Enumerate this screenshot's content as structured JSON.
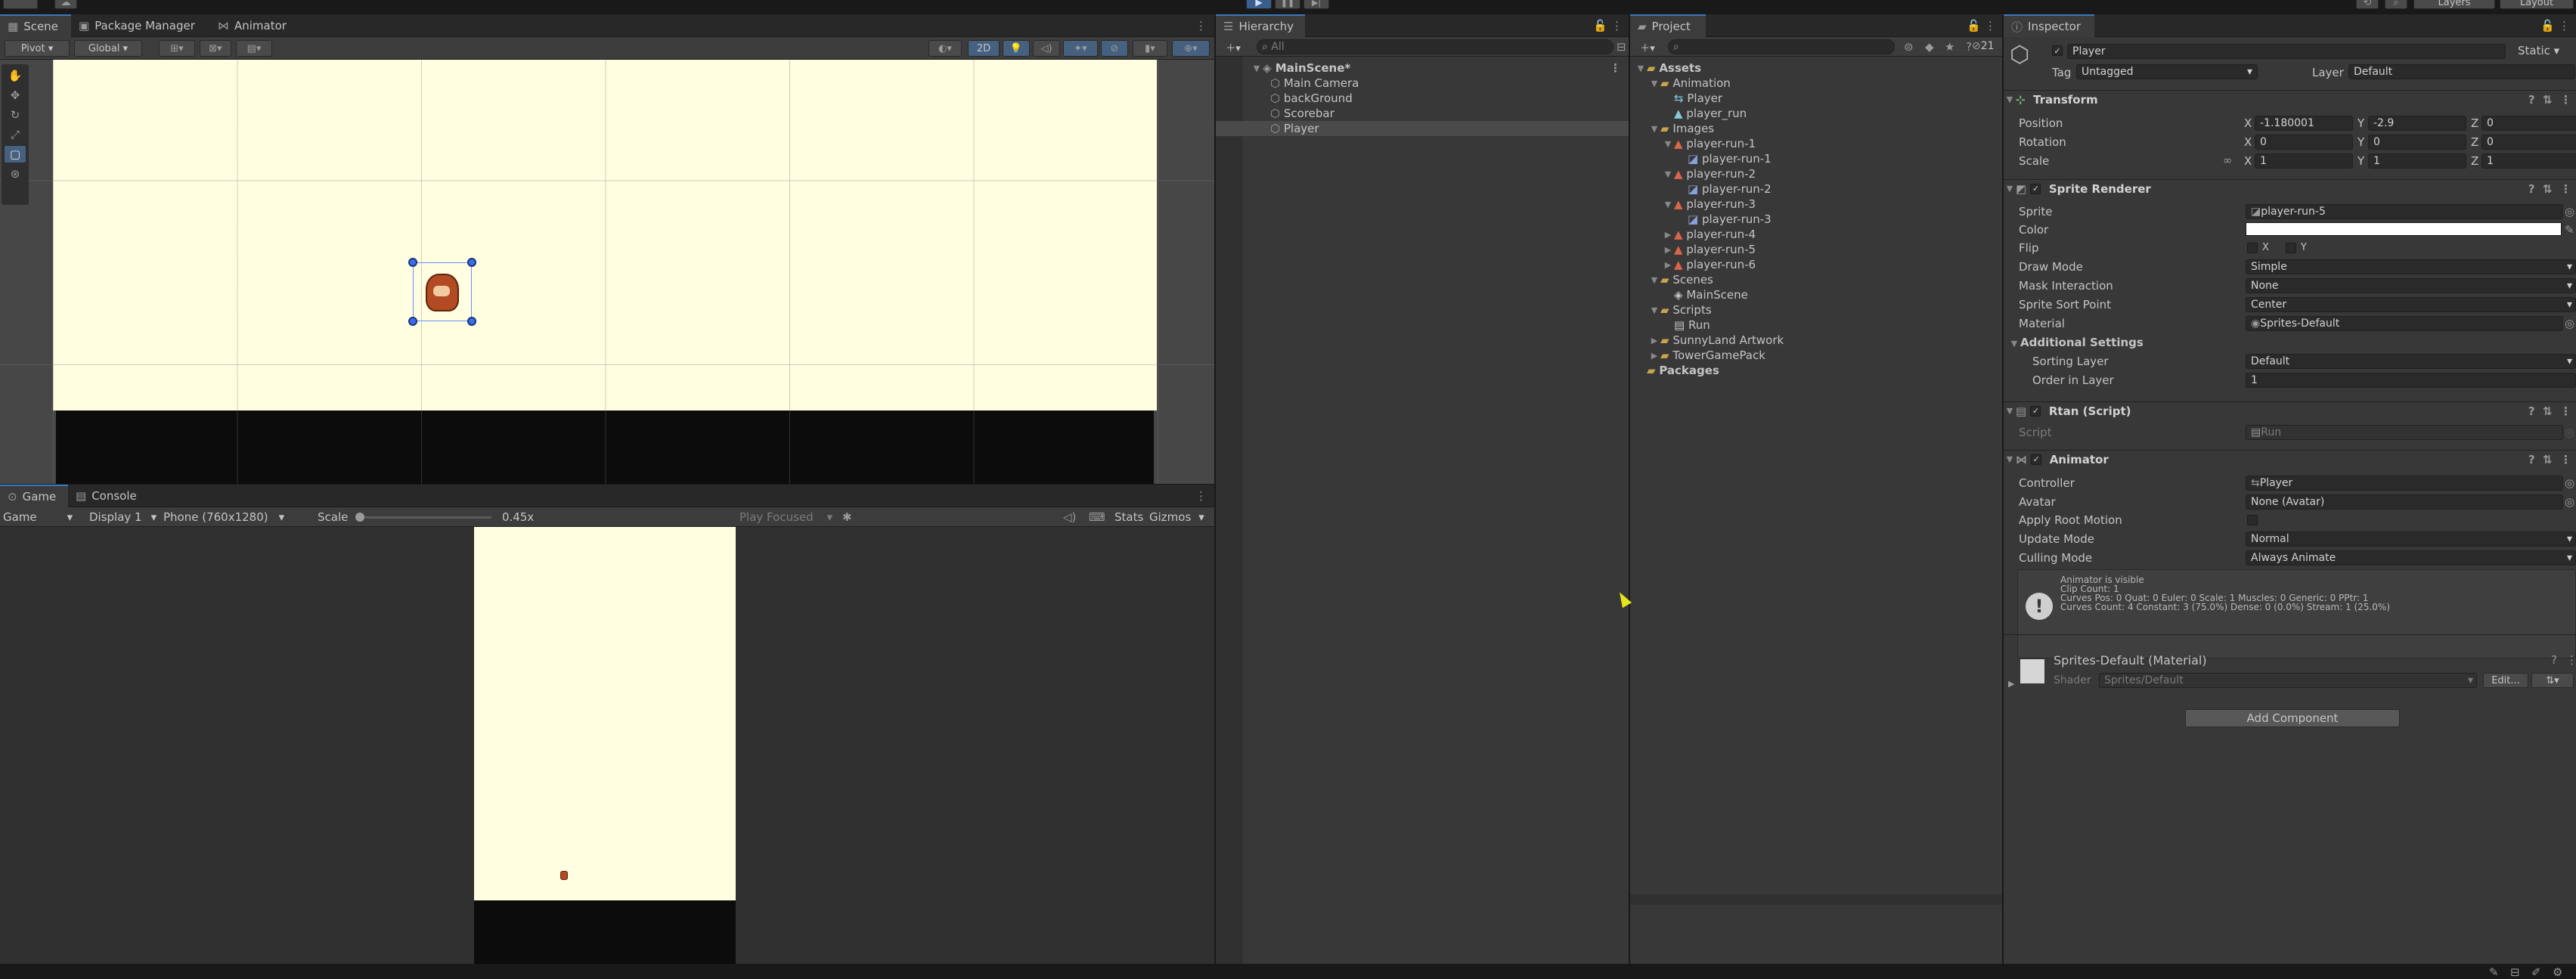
{
  "top_toolbar": {
    "layers": "Layers",
    "layout": "Layout"
  },
  "scene_tabs": [
    "Scene",
    "Package Manager",
    "Animator"
  ],
  "scene_toolbar": {
    "pivot": "Pivot",
    "global": "Global",
    "two_d": "2D"
  },
  "game_tabs": [
    "Game",
    "Console"
  ],
  "game_toolbar": {
    "mode": "Game",
    "display": "Display 1",
    "resolution": "Phone (760x1280)",
    "scale_label": "Scale",
    "scale_value": "0.45x",
    "play_focused": "Play Focused",
    "stats": "Stats",
    "gizmos": "Gizmos"
  },
  "hierarchy": {
    "tab": "Hierarchy",
    "search_placeholder": "All",
    "scene": "MainScene*",
    "items": [
      "Main Camera",
      "backGround",
      "Scorebar",
      "Player"
    ]
  },
  "project": {
    "tab": "Project",
    "hidden_count": "21",
    "tree": [
      {
        "label": "Assets",
        "depth": 0,
        "icon": "folder",
        "exp": "open"
      },
      {
        "label": "Animation",
        "depth": 1,
        "icon": "folder",
        "exp": "open"
      },
      {
        "label": "Player",
        "depth": 2,
        "icon": "anim",
        "exp": ""
      },
      {
        "label": "player_run",
        "depth": 2,
        "icon": "clip",
        "exp": ""
      },
      {
        "label": "Images",
        "depth": 1,
        "icon": "folder",
        "exp": "open"
      },
      {
        "label": "player-run-1",
        "depth": 2,
        "icon": "tex",
        "exp": "open"
      },
      {
        "label": "player-run-1",
        "depth": 3,
        "icon": "sprite",
        "exp": ""
      },
      {
        "label": "player-run-2",
        "depth": 2,
        "icon": "tex",
        "exp": "open"
      },
      {
        "label": "player-run-2",
        "depth": 3,
        "icon": "sprite",
        "exp": ""
      },
      {
        "label": "player-run-3",
        "depth": 2,
        "icon": "tex",
        "exp": "open"
      },
      {
        "label": "player-run-3",
        "depth": 3,
        "icon": "sprite",
        "exp": ""
      },
      {
        "label": "player-run-4",
        "depth": 2,
        "icon": "tex",
        "exp": "closed"
      },
      {
        "label": "player-run-5",
        "depth": 2,
        "icon": "tex",
        "exp": "closed"
      },
      {
        "label": "player-run-6",
        "depth": 2,
        "icon": "tex",
        "exp": "closed"
      },
      {
        "label": "Scenes",
        "depth": 1,
        "icon": "folder",
        "exp": "open"
      },
      {
        "label": "MainScene",
        "depth": 2,
        "icon": "unity",
        "exp": ""
      },
      {
        "label": "Scripts",
        "depth": 1,
        "icon": "folder",
        "exp": "open"
      },
      {
        "label": "Run",
        "depth": 2,
        "icon": "script",
        "exp": ""
      },
      {
        "label": "SunnyLand Artwork",
        "depth": 1,
        "icon": "folder",
        "exp": "closed"
      },
      {
        "label": "TowerGamePack",
        "depth": 1,
        "icon": "folder",
        "exp": "closed"
      },
      {
        "label": "Packages",
        "depth": 0,
        "icon": "folder",
        "exp": ""
      }
    ]
  },
  "inspector": {
    "tab": "Inspector",
    "object_name": "Player",
    "static": "Static",
    "tag_label": "Tag",
    "tag_value": "Untagged",
    "layer_label": "Layer",
    "layer_value": "Default",
    "transform": {
      "title": "Transform",
      "position_label": "Position",
      "position": [
        "-1.180001",
        "-2.9",
        "0"
      ],
      "rotation_label": "Rotation",
      "rotation": [
        "0",
        "0",
        "0"
      ],
      "scale_label": "Scale",
      "scale": [
        "1",
        "1",
        "1"
      ]
    },
    "sprite_renderer": {
      "title": "Sprite Renderer",
      "sprite_label": "Sprite",
      "sprite": "player-run-5",
      "color_label": "Color",
      "flip_label": "Flip",
      "flip_x": "X",
      "flip_y": "Y",
      "draw_mode_label": "Draw Mode",
      "draw_mode": "Simple",
      "mask_label": "Mask Interaction",
      "mask": "None",
      "sort_point_label": "Sprite Sort Point",
      "sort_point": "Center",
      "material_label": "Material",
      "material": "Sprites-Default",
      "additional": "Additional Settings",
      "sorting_layer_label": "Sorting Layer",
      "sorting_layer": "Default",
      "order_label": "Order in Layer",
      "order": "1"
    },
    "script": {
      "title": "Rtan (Script)",
      "script_label": "Script",
      "script_value": "Run"
    },
    "animator": {
      "title": "Animator",
      "controller_label": "Controller",
      "controller": "Player",
      "avatar_label": "Avatar",
      "avatar": "None (Avatar)",
      "root_motion_label": "Apply Root Motion",
      "update_mode_label": "Update Mode",
      "update_mode": "Normal",
      "culling_label": "Culling Mode",
      "culling": "Always Animate",
      "info": [
        "Animator is visible",
        "Clip Count: 1",
        "Curves Pos: 0 Quat: 0 Euler: 0 Scale: 1 Muscles: 0 Generic: 0 PPtr: 1",
        "Curves Count: 4 Constant: 3 (75.0%) Dense: 0 (0.0%) Stream: 1 (25.0%)"
      ]
    },
    "material": {
      "title": "Sprites-Default (Material)",
      "shader_label": "Shader",
      "shader": "Sprites/Default",
      "edit": "Edit..."
    },
    "add_component": "Add Component"
  }
}
